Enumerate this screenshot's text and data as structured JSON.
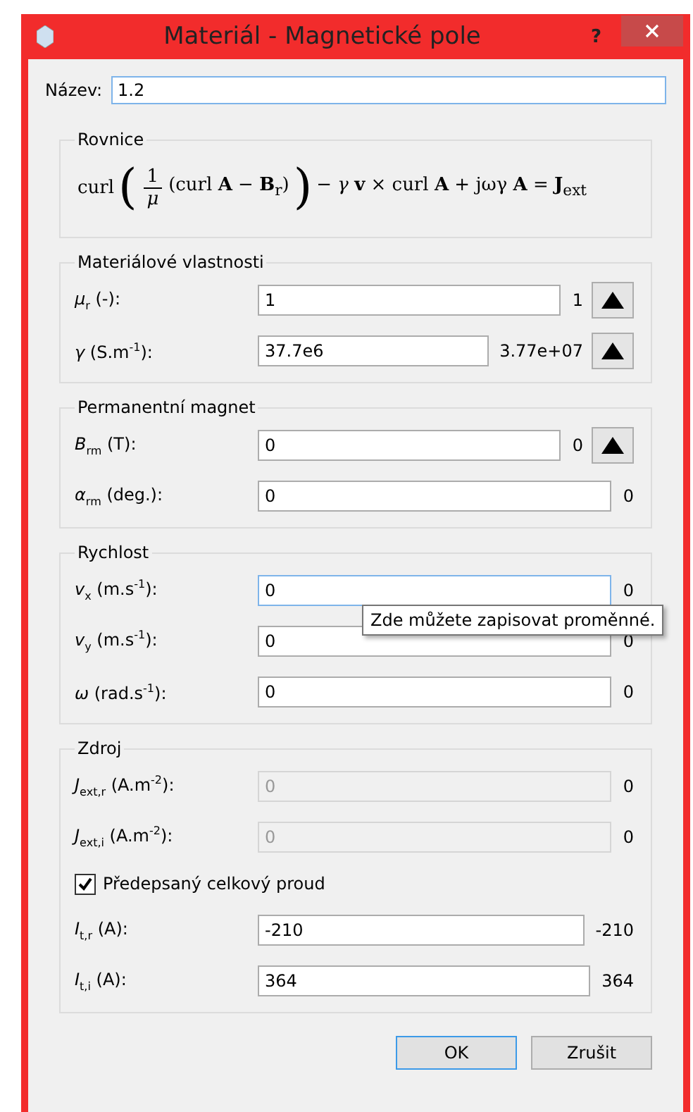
{
  "window": {
    "title": "Materiál - Magnetické pole",
    "help": "?"
  },
  "name": {
    "label": "Název:",
    "value": "1.2"
  },
  "equation": {
    "title": "Rovnice",
    "lead": "curl",
    "open": "(",
    "numerator": "1",
    "denominator": "*μ*",
    "inner": "(curl **A** − **B**$_{r}$)",
    "close": ")",
    "rest": "− *γ* **v** × curl **A** + jωγ **A** = **J**$_{ext}$"
  },
  "groups": [
    {
      "title": "Materiálové vlastnosti",
      "rows": [
        {
          "kind": "field_button",
          "label": "*μ*$_{r}$ (-):",
          "value": "1",
          "reading": "1",
          "disabled": false,
          "focused": false
        },
        {
          "kind": "field_button",
          "label": "*γ* (S.m$^{-1}$):",
          "value": "37.7e6",
          "reading": "3.77e+07",
          "disabled": false,
          "focused": false
        }
      ]
    },
    {
      "title": "Permanentní magnet",
      "rows": [
        {
          "kind": "field_button",
          "label": "*B*$_{rm}$ (T):",
          "value": "0",
          "reading": "0",
          "disabled": false,
          "focused": false
        },
        {
          "kind": "field",
          "label": "*α*$_{rm}$ (deg.):",
          "value": "0",
          "reading": "0",
          "disabled": false,
          "focused": false
        }
      ]
    },
    {
      "title": "Rychlost",
      "rows": [
        {
          "kind": "field",
          "label": "*v*$_{x}$ (m.s$^{-1}$):",
          "value": "0",
          "reading": "0",
          "disabled": false,
          "focused": true,
          "tooltip": "Zde můžete zapisovat proměnné."
        },
        {
          "kind": "field",
          "label": "*v*$_{y}$ (m.s$^{-1}$):",
          "value": "0",
          "reading": "0",
          "disabled": false,
          "focused": false
        },
        {
          "kind": "field",
          "label": "*ω* (rad.s$^{-1}$):",
          "value": "0",
          "reading": "0",
          "disabled": false,
          "focused": false
        }
      ]
    },
    {
      "title": "Zdroj",
      "rows": [
        {
          "kind": "field",
          "label": "*J*$_{ext,r}$ (A.m$^{-2}$):",
          "value": "0",
          "reading": "0",
          "disabled": true,
          "focused": false
        },
        {
          "kind": "field",
          "label": "*J*$_{ext,i}$ (A.m$^{-2}$):",
          "value": "0",
          "reading": "0",
          "disabled": true,
          "focused": false
        },
        {
          "kind": "checkbox",
          "label": "Předepsaný celkový proud",
          "checked": true
        },
        {
          "kind": "field",
          "label": "*I*$_{t,r}$ (A):",
          "value": "-210",
          "reading": "-210",
          "disabled": false,
          "focused": false
        },
        {
          "kind": "field",
          "label": "*I*$_{t,i}$ (A):",
          "value": "364",
          "reading": "364",
          "disabled": false,
          "focused": false
        }
      ]
    }
  ],
  "buttons": [
    {
      "label": "OK",
      "default": true
    },
    {
      "label": "Zrušit",
      "default": false
    }
  ]
}
